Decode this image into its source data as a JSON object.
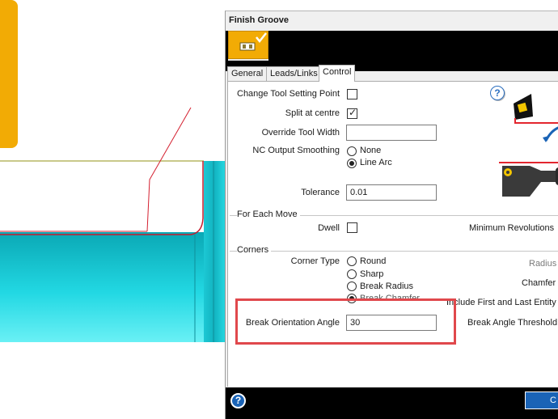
{
  "dialog": {
    "title": "Finish Groove",
    "tabs": [
      {
        "label": "General"
      },
      {
        "label": "Leads/Links"
      },
      {
        "label": "Control"
      }
    ],
    "footer_button_label": "C",
    "help_glyph": "?",
    "panel_help_glyph": "?"
  },
  "control": {
    "change_tool_setting_point": {
      "label": "Change Tool Setting Point",
      "checked": false
    },
    "split_at_centre": {
      "label": "Split at centre",
      "checked": true
    },
    "override_tool_width": {
      "label": "Override Tool Width",
      "value": ""
    },
    "nc_output_smoothing": {
      "label": "NC Output Smoothing",
      "options": [
        "None",
        "Line Arc"
      ],
      "selected": "Line Arc"
    },
    "tolerance": {
      "label": "Tolerance",
      "value": "0.01"
    }
  },
  "for_each_move": {
    "title": "For Each Move",
    "dwell": {
      "label": "Dwell",
      "checked": false
    },
    "minimum_revolutions_label": "Minimum Revolutions"
  },
  "corners": {
    "title": "Corners",
    "corner_type_label": "Corner Type",
    "options": [
      "Round",
      "Sharp",
      "Break Radius",
      "Break Chamfer"
    ],
    "selected": "Break Chamfer",
    "radius_label": "Radius",
    "chamfer_label": "Chamfer",
    "include_first_last_label": "Include First and Last Entity",
    "break_orientation_angle": {
      "label": "Break Orientation Angle",
      "value": "30"
    },
    "break_angle_threshold_label": "Break Angle Threshold"
  },
  "icons": {
    "tool_button": "finish-groove-tool-icon",
    "help": "help-icon",
    "tool_orientation": "tool-orientation-icon",
    "tool_holder": "tool-holder-icon"
  },
  "colors": {
    "accent_yellow": "#f2ab05",
    "part_cyan": "#22d4e0",
    "highlight_red": "#e0484c",
    "button_blue": "#1a63b6"
  }
}
